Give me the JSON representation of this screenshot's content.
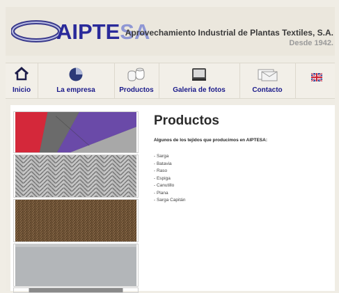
{
  "header": {
    "logo_text_main": "AIPTE",
    "logo_text_tail": "SA",
    "company_name": "Aprovechamiento Industrial de Plantas Textiles, S.A.",
    "since": "Desde 1942."
  },
  "nav": {
    "items": [
      {
        "label": "Inicio",
        "icon": "home-icon"
      },
      {
        "label": "La empresa",
        "icon": "pie-chart-icon"
      },
      {
        "label": "Productos",
        "icon": "thread-spools-icon"
      },
      {
        "label": "Galeria de fotos",
        "icon": "photo-album-icon"
      },
      {
        "label": "Contacto",
        "icon": "envelope-icon"
      }
    ],
    "language_icon": "uk-flag-icon"
  },
  "main": {
    "title": "Productos",
    "intro": "Algunos de los tejidos que producimos en AIPTESA:",
    "products": [
      "- Sarga",
      "- Batavia",
      "- Raso",
      "- Espiga",
      "- Canutillo",
      "- Plana",
      "- Sarga Capitán"
    ]
  },
  "colors": {
    "brand_blue": "#2a2a9a",
    "brand_light": "#8f97d4",
    "nav_text": "#1a1a8a"
  }
}
